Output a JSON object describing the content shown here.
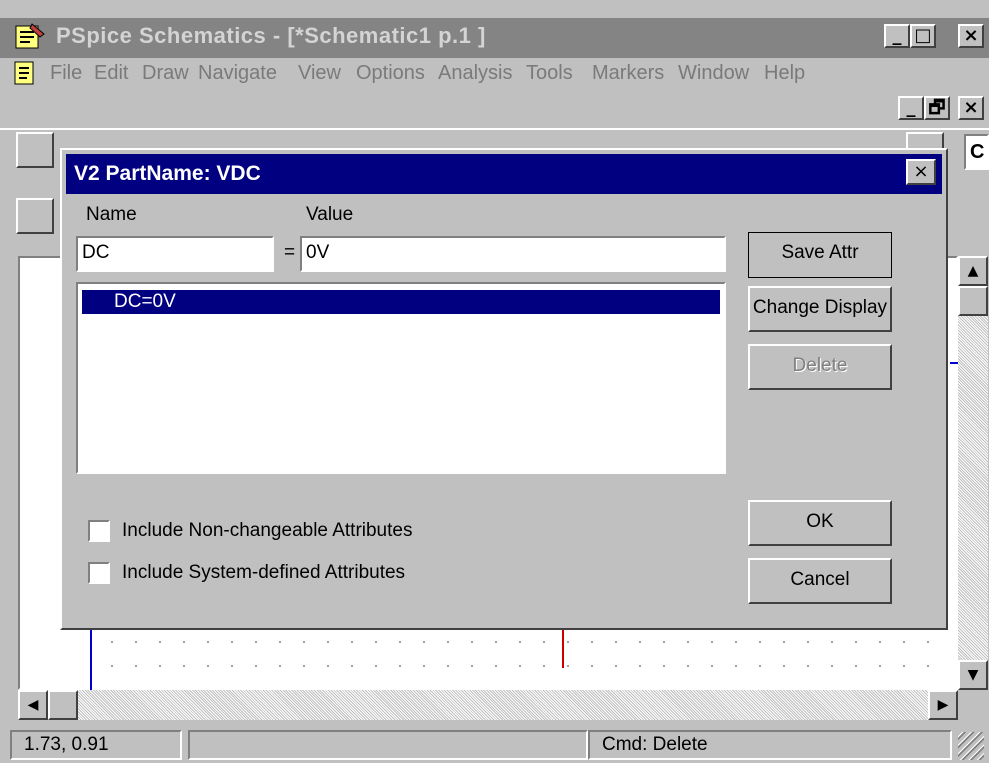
{
  "app": {
    "title": "PSpice Schematics - [*Schematic1  p.1   ]",
    "window_buttons": [
      "_",
      "□",
      "×"
    ],
    "mdi_buttons": [
      "_",
      "🗗",
      "×"
    ]
  },
  "menu": [
    {
      "label": "File"
    },
    {
      "label": "Edit"
    },
    {
      "label": "Draw"
    },
    {
      "label": "Navigate"
    },
    {
      "label": "View"
    },
    {
      "label": "Options"
    },
    {
      "label": "Analysis"
    },
    {
      "label": "Tools"
    },
    {
      "label": "Markers"
    },
    {
      "label": "Window"
    },
    {
      "label": "Help"
    }
  ],
  "toolbar": {
    "combo_value": "C"
  },
  "dialog": {
    "title": "V2   PartName: VDC",
    "close_label": "×",
    "name_label": "Name",
    "value_label": "Value",
    "name_value": "DC",
    "equals": "=",
    "value_value": "0V",
    "list_items": [
      "DC=0V"
    ],
    "buttons": {
      "save_attr": "Save Attr",
      "change_display": "Change Display",
      "delete": "Delete",
      "ok": "OK",
      "cancel": "Cancel"
    },
    "checkboxes": {
      "non_changeable": "Include Non-changeable Attributes",
      "system_defined": "Include System-defined Attributes"
    }
  },
  "status": {
    "coords": "1.73,  0.91",
    "middle": "",
    "command": "Cmd: Delete"
  },
  "colors": {
    "title_active": "#000080",
    "title_inactive": "#848484",
    "wire_blue": "#0000cc",
    "wire_red": "#cc0000"
  }
}
